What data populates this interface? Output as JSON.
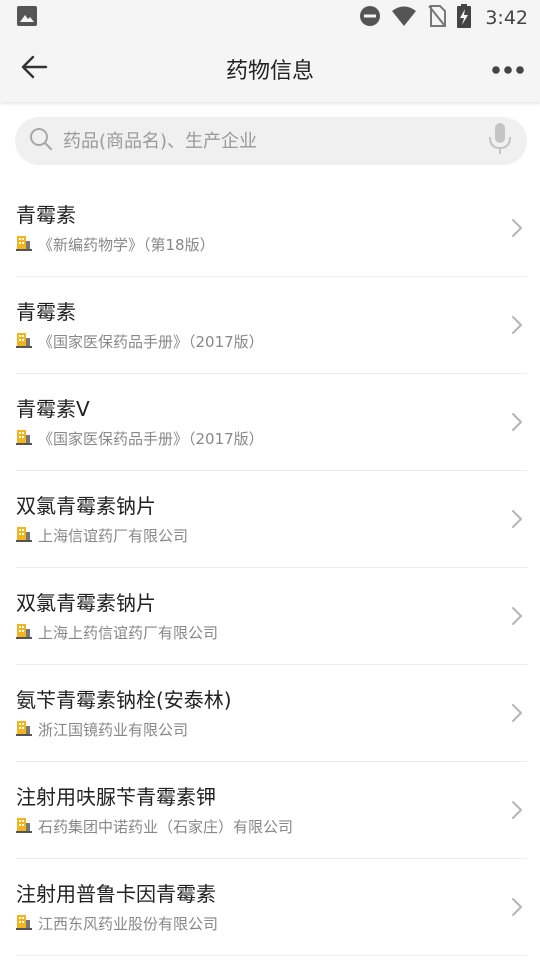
{
  "status_bar": {
    "time": "3:42",
    "icons": [
      "image-icon",
      "do-not-disturb-icon",
      "wifi-icon",
      "no-sim-icon",
      "battery-charging-icon"
    ]
  },
  "app_bar": {
    "title": "药物信息",
    "back_icon": "arrow-left-icon",
    "more_icon": "more-horizontal-icon"
  },
  "search": {
    "placeholder": "药品(商品名)、生产企业",
    "value": "",
    "icons": [
      "search-icon",
      "microphone-icon"
    ]
  },
  "colors": {
    "source_icon_yellow": "#f2b51e",
    "source_icon_gray": "#777777"
  },
  "drugs": [
    {
      "name": "青霉素",
      "source": "《新编药物学》（第18版）"
    },
    {
      "name": "青霉素",
      "source": "《国家医保药品手册》（2017版）"
    },
    {
      "name": "青霉素V",
      "source": "《国家医保药品手册》（2017版）"
    },
    {
      "name": "双氯青霉素钠片",
      "source": "上海信谊药厂有限公司"
    },
    {
      "name": "双氯青霉素钠片",
      "source": "上海上药信谊药厂有限公司"
    },
    {
      "name": "氨苄青霉素钠栓(安泰林)",
      "source": "浙江国镜药业有限公司"
    },
    {
      "name": "注射用呋脲苄青霉素钾",
      "source": "石药集团中诺药业（石家庄）有限公司"
    },
    {
      "name": "注射用普鲁卡因青霉素",
      "source": "江西东风药业股份有限公司"
    }
  ]
}
